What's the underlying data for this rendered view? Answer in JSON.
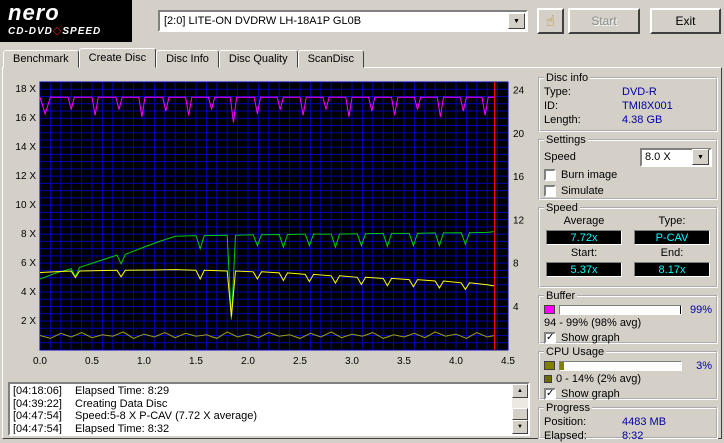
{
  "icons": {
    "dropdown_arrow": "▼",
    "hand": "☝",
    "check": "✓",
    "scroll_up": "▲",
    "scroll_down": "▼",
    "diamond": "◇"
  },
  "header": {
    "logo_line1": "nero",
    "logo_cd_dvd": "CD-DVD",
    "logo_speed": "SPEED",
    "device_dropdown": "[2:0]   LITE-ON DVDRW LH-18A1P GL0B",
    "start_button": "Start",
    "exit_button": "Exit"
  },
  "tabs": [
    "Benchmark",
    "Create Disc",
    "Disc Info",
    "Disc Quality",
    "ScanDisc"
  ],
  "chart_data": {
    "type": "line",
    "bg": "#000000",
    "grid": {
      "color": "#0000b4",
      "x_step": 0.1,
      "y_step": 0.5
    },
    "x_range": [
      0,
      4.5
    ],
    "x_ticks": [
      {
        "v": 0,
        "label": "0.0"
      },
      {
        "v": 0.5,
        "label": "0.5"
      },
      {
        "v": 1,
        "label": "1.0"
      },
      {
        "v": 1.5,
        "label": "1.5"
      },
      {
        "v": 2,
        "label": "2.0"
      },
      {
        "v": 2.5,
        "label": "2.5"
      },
      {
        "v": 3,
        "label": "3.0"
      },
      {
        "v": 3.5,
        "label": "3.5"
      },
      {
        "v": 4,
        "label": "4.0"
      },
      {
        "v": 4.5,
        "label": "4.5"
      }
    ],
    "left_axis": {
      "range": [
        0,
        18.5
      ],
      "ticks": [
        {
          "v": 2,
          "label": "2 X"
        },
        {
          "v": 4,
          "label": "4 X"
        },
        {
          "v": 6,
          "label": "6 X"
        },
        {
          "v": 8,
          "label": "8 X"
        },
        {
          "v": 10,
          "label": "10 X"
        },
        {
          "v": 12,
          "label": "12 X"
        },
        {
          "v": 14,
          "label": "14 X"
        },
        {
          "v": 16,
          "label": "16 X"
        },
        {
          "v": 18,
          "label": "18 X"
        }
      ]
    },
    "right_axis": {
      "range": [
        0,
        24.8
      ],
      "ticks": [
        {
          "v": 4,
          "label": "4"
        },
        {
          "v": 8,
          "label": "8"
        },
        {
          "v": 12,
          "label": "12"
        },
        {
          "v": 16,
          "label": "16"
        },
        {
          "v": 20,
          "label": "20"
        },
        {
          "v": 24,
          "label": "24"
        }
      ]
    },
    "cursor_x": 4.37,
    "cursor_color": "#ff0000",
    "series": [
      {
        "name": "buffer-level",
        "color": "#ff00ff",
        "axis": "left",
        "points": [
          [
            0,
            17.45
          ],
          [
            0.05,
            16.3
          ],
          [
            0.1,
            17.45
          ],
          [
            0.27,
            17.45
          ],
          [
            0.3,
            16.6
          ],
          [
            0.33,
            17.45
          ],
          [
            0.5,
            17.45
          ],
          [
            0.53,
            16.2
          ],
          [
            0.56,
            17.45
          ],
          [
            0.73,
            17.45
          ],
          [
            0.76,
            16.6
          ],
          [
            0.79,
            17.45
          ],
          [
            0.95,
            17.45
          ],
          [
            0.98,
            16.1
          ],
          [
            1.01,
            17.45
          ],
          [
            1.18,
            17.45
          ],
          [
            1.21,
            16.5
          ],
          [
            1.24,
            17.45
          ],
          [
            1.4,
            17.45
          ],
          [
            1.43,
            16.2
          ],
          [
            1.46,
            17.45
          ],
          [
            1.62,
            17.45
          ],
          [
            1.65,
            16.6
          ],
          [
            1.68,
            17.45
          ],
          [
            1.83,
            17.45
          ],
          [
            1.86,
            15.7
          ],
          [
            1.89,
            17.45
          ],
          [
            2.06,
            17.45
          ],
          [
            2.09,
            16.3
          ],
          [
            2.12,
            17.45
          ],
          [
            2.28,
            17.45
          ],
          [
            2.31,
            16.6
          ],
          [
            2.34,
            17.45
          ],
          [
            2.5,
            17.45
          ],
          [
            2.53,
            16.2
          ],
          [
            2.56,
            17.45
          ],
          [
            2.72,
            17.45
          ],
          [
            2.75,
            16.6
          ],
          [
            2.78,
            17.45
          ],
          [
            2.94,
            17.45
          ],
          [
            2.97,
            16.1
          ],
          [
            3.0,
            17.45
          ],
          [
            3.16,
            17.45
          ],
          [
            3.19,
            16.5
          ],
          [
            3.22,
            17.45
          ],
          [
            3.38,
            17.45
          ],
          [
            3.41,
            16.2
          ],
          [
            3.44,
            17.45
          ],
          [
            3.6,
            17.45
          ],
          [
            3.63,
            16.6
          ],
          [
            3.66,
            17.45
          ],
          [
            3.82,
            17.45
          ],
          [
            3.85,
            16.1
          ],
          [
            3.88,
            17.45
          ],
          [
            4.04,
            17.45
          ],
          [
            4.07,
            16.5
          ],
          [
            4.1,
            17.45
          ],
          [
            4.25,
            17.45
          ],
          [
            4.28,
            16.2
          ],
          [
            4.31,
            17.45
          ],
          [
            4.37,
            17.45
          ]
        ]
      },
      {
        "name": "write-speed",
        "color": "#00cc00",
        "axis": "left",
        "points": [
          [
            0,
            4.9
          ],
          [
            0.15,
            5.3
          ],
          [
            0.3,
            5.62
          ],
          [
            0.34,
            5.05
          ],
          [
            0.38,
            5.7
          ],
          [
            0.55,
            6.1
          ],
          [
            0.74,
            6.55
          ],
          [
            0.78,
            5.95
          ],
          [
            0.82,
            6.6
          ],
          [
            1.0,
            7.1
          ],
          [
            1.15,
            7.5
          ],
          [
            1.3,
            7.85
          ],
          [
            1.5,
            7.9
          ],
          [
            1.54,
            7.0
          ],
          [
            1.58,
            7.9
          ],
          [
            1.8,
            7.92
          ],
          [
            1.84,
            2.1
          ],
          [
            1.88,
            7.92
          ],
          [
            2.05,
            7.95
          ],
          [
            2.09,
            7.2
          ],
          [
            2.13,
            7.95
          ],
          [
            2.3,
            7.97
          ],
          [
            2.34,
            7.1
          ],
          [
            2.38,
            7.97
          ],
          [
            2.55,
            8.0
          ],
          [
            2.59,
            7.2
          ],
          [
            2.63,
            8.0
          ],
          [
            2.8,
            8.0
          ],
          [
            2.84,
            7.1
          ],
          [
            2.88,
            8.0
          ],
          [
            3.05,
            8.02
          ],
          [
            3.09,
            7.2
          ],
          [
            3.13,
            8.02
          ],
          [
            3.3,
            8.05
          ],
          [
            3.34,
            7.15
          ],
          [
            3.38,
            8.05
          ],
          [
            3.55,
            8.05
          ],
          [
            3.59,
            7.2
          ],
          [
            3.63,
            8.05
          ],
          [
            3.8,
            8.08
          ],
          [
            3.84,
            7.2
          ],
          [
            3.88,
            8.08
          ],
          [
            4.05,
            8.1
          ],
          [
            4.09,
            7.3
          ],
          [
            4.13,
            8.1
          ],
          [
            4.3,
            8.12
          ],
          [
            4.37,
            8.17
          ]
        ]
      },
      {
        "name": "secondary-speed",
        "color": "#ffff00",
        "axis": "left",
        "points": [
          [
            0,
            5.35
          ],
          [
            0.3,
            5.45
          ],
          [
            0.34,
            5.0
          ],
          [
            0.38,
            5.45
          ],
          [
            0.74,
            5.5
          ],
          [
            0.78,
            5.05
          ],
          [
            0.82,
            5.5
          ],
          [
            1.1,
            5.52
          ],
          [
            1.3,
            5.55
          ],
          [
            1.5,
            5.5
          ],
          [
            1.54,
            4.9
          ],
          [
            1.58,
            5.5
          ],
          [
            1.8,
            5.45
          ],
          [
            1.84,
            2.3
          ],
          [
            1.88,
            5.45
          ],
          [
            2.05,
            5.4
          ],
          [
            2.09,
            4.9
          ],
          [
            2.13,
            5.4
          ],
          [
            2.3,
            5.32
          ],
          [
            2.34,
            4.8
          ],
          [
            2.38,
            5.32
          ],
          [
            2.55,
            5.22
          ],
          [
            2.59,
            4.72
          ],
          [
            2.63,
            5.22
          ],
          [
            2.8,
            5.12
          ],
          [
            2.84,
            4.62
          ],
          [
            2.88,
            5.12
          ],
          [
            3.05,
            5.02
          ],
          [
            3.09,
            4.52
          ],
          [
            3.13,
            5.02
          ],
          [
            3.3,
            4.94
          ],
          [
            3.34,
            4.44
          ],
          [
            3.38,
            4.94
          ],
          [
            3.55,
            4.86
          ],
          [
            3.59,
            4.36
          ],
          [
            3.63,
            4.86
          ],
          [
            3.8,
            4.76
          ],
          [
            3.84,
            4.28
          ],
          [
            3.88,
            4.76
          ],
          [
            4.05,
            4.64
          ],
          [
            4.09,
            4.18
          ],
          [
            4.13,
            4.64
          ],
          [
            4.3,
            4.5
          ],
          [
            4.37,
            4.42
          ]
        ]
      },
      {
        "name": "cpu-usage",
        "color": "#a0a000",
        "axis": "left",
        "points": [
          [
            0,
            1.0
          ],
          [
            0.1,
            0.8
          ],
          [
            0.2,
            1.15
          ],
          [
            0.3,
            0.9
          ],
          [
            0.4,
            1.2
          ],
          [
            0.5,
            0.85
          ],
          [
            0.6,
            1.05
          ],
          [
            0.7,
            0.95
          ],
          [
            0.8,
            1.25
          ],
          [
            0.9,
            0.8
          ],
          [
            1.0,
            1.1
          ],
          [
            1.1,
            0.9
          ],
          [
            1.2,
            1.2
          ],
          [
            1.3,
            0.85
          ],
          [
            1.4,
            1.15
          ],
          [
            1.5,
            0.95
          ],
          [
            1.6,
            1.05
          ],
          [
            1.7,
            0.8
          ],
          [
            1.8,
            1.25
          ],
          [
            1.9,
            0.9
          ],
          [
            2.0,
            1.1
          ],
          [
            2.1,
            0.85
          ],
          [
            2.2,
            1.2
          ],
          [
            2.3,
            0.95
          ],
          [
            2.4,
            1.05
          ],
          [
            2.5,
            0.8
          ],
          [
            2.6,
            1.15
          ],
          [
            2.7,
            0.9
          ],
          [
            2.8,
            1.25
          ],
          [
            2.9,
            0.85
          ],
          [
            3.0,
            1.1
          ],
          [
            3.1,
            0.95
          ],
          [
            3.2,
            1.2
          ],
          [
            3.3,
            0.8
          ],
          [
            3.4,
            1.05
          ],
          [
            3.5,
            0.9
          ],
          [
            3.6,
            1.15
          ],
          [
            3.7,
            0.85
          ],
          [
            3.8,
            1.25
          ],
          [
            3.9,
            0.95
          ],
          [
            4.0,
            1.1
          ],
          [
            4.1,
            0.8
          ],
          [
            4.2,
            1.2
          ],
          [
            4.3,
            0.9
          ],
          [
            4.37,
            1.0
          ]
        ]
      }
    ]
  },
  "sidebar": {
    "disc_info": {
      "title": "Disc info",
      "rows": [
        {
          "label": "Type:",
          "value": "DVD-R"
        },
        {
          "label": "ID:",
          "value": "TMI8X001"
        },
        {
          "label": "Length:",
          "value": "4.38 GB"
        }
      ]
    },
    "settings": {
      "title": "Settings",
      "speed_label": "Speed",
      "speed_value": "8.0 X",
      "checkboxes": [
        {
          "label": "Burn image",
          "checked": false
        },
        {
          "label": "Simulate",
          "checked": false
        }
      ]
    },
    "speed": {
      "title": "Speed",
      "average_label": "Average",
      "average_value": "7.72x",
      "type_label": "Type:",
      "type_value": "P-CAV",
      "start_label": "Start:",
      "start_value": "5.37x",
      "end_label": "End:",
      "end_value": "8.17x"
    },
    "buffer": {
      "title": "Buffer",
      "swatch_color": "#ff00ff",
      "bar_bg": "#000000",
      "bar_fill": "#ffffff",
      "percent_num": 99,
      "percent": "99%",
      "range_text": "94 - 99% (98% avg)",
      "show_graph_label": "Show graph",
      "show_graph_checked": true
    },
    "cpu": {
      "title": "CPU Usage",
      "swatch_color": "#808000",
      "bar_bg": "#ffffff",
      "bar_fill": "#808000",
      "percent_num": 3,
      "percent": "3%",
      "range_text": "0 - 14% (2% avg)",
      "avg_swatch_color": "#6b6b00",
      "show_graph_label": "Show graph",
      "show_graph_checked": true
    },
    "progress": {
      "title": "Progress",
      "rows": [
        {
          "label": "Position:",
          "value": "4483 MB"
        },
        {
          "label": "Elapsed:",
          "value": "8:32"
        }
      ]
    }
  },
  "log": {
    "lines": [
      {
        "time": "[04:18:06]",
        "text": "Elapsed Time: 8:29"
      },
      {
        "time": "[04:39:22]",
        "text": "Creating Data Disc"
      },
      {
        "time": "[04:47:54]",
        "text": "Speed:5-8 X P-CAV (7.72 X average)"
      },
      {
        "time": "[04:47:54]",
        "text": "Elapsed Time: 8:32"
      }
    ]
  }
}
